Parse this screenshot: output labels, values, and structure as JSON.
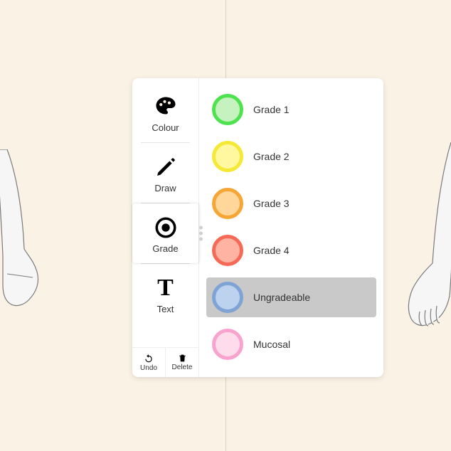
{
  "tools": {
    "colour": {
      "label": "Colour"
    },
    "draw": {
      "label": "Draw"
    },
    "grade": {
      "label": "Grade"
    },
    "text": {
      "label": "Text",
      "glyph": "T"
    }
  },
  "footer": {
    "undo": {
      "label": "Undo"
    },
    "delete": {
      "label": "Delete"
    }
  },
  "grade_options": [
    {
      "label": "Grade 1",
      "fill": "#c6f2c0",
      "ring": "#4fe24f",
      "selected": false
    },
    {
      "label": "Grade 2",
      "fill": "#fff8a0",
      "ring": "#f5e837",
      "selected": false
    },
    {
      "label": "Grade 3",
      "fill": "#ffd79a",
      "ring": "#f5a637",
      "selected": false
    },
    {
      "label": "Grade 4",
      "fill": "#ffb3a3",
      "ring": "#f56a56",
      "selected": false
    },
    {
      "label": "Ungradeable",
      "fill": "#bcd2ee",
      "ring": "#7fa3d4",
      "selected": true
    },
    {
      "label": "Mucosal",
      "fill": "#ffdcec",
      "ring": "#f7a3cd",
      "selected": false
    }
  ]
}
